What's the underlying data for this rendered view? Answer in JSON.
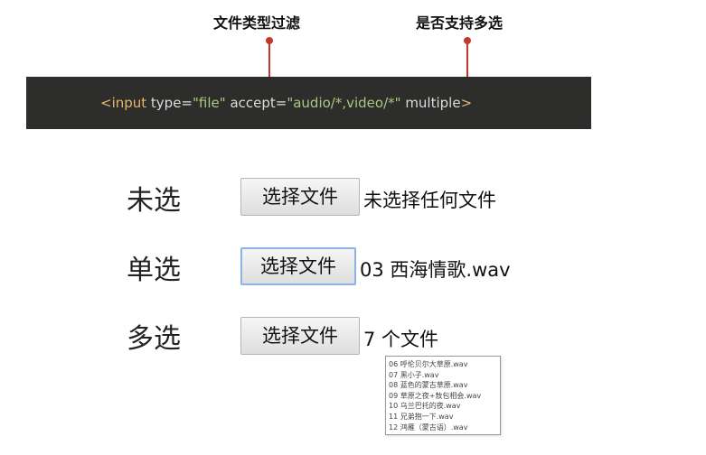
{
  "annotations": {
    "file_type_filter": "文件类型过滤",
    "multiple_select": "是否支持多选"
  },
  "colors": {
    "pointer": "#c0392b",
    "banner_bg": "#2d2d2b",
    "tag": "#e8b56a",
    "attr": "#dcdcdc",
    "value": "#a8c97f"
  },
  "code": {
    "open": "<input",
    "type_attr": " type=",
    "type_val": "\"file\"",
    "accept_attr": " accept=",
    "accept_val": "\"audio/*,video/*\"",
    "multiple_attr": " multiple",
    "close": ">"
  },
  "rows": {
    "none": {
      "label": "未选",
      "button": "选择文件",
      "status": "未选择任何文件"
    },
    "single": {
      "label": "单选",
      "button": "选择文件",
      "status": "03 西海情歌.wav"
    },
    "multi": {
      "label": "多选",
      "button": "选择文件",
      "status": "7 个文件"
    }
  },
  "tooltip": {
    "files": [
      "06 呼伦贝尔大草原.wav",
      "07 黑小子.wav",
      "08 蓝色的蒙古草原.wav",
      "09 草原之夜+敖包相会.wav",
      "10 乌兰巴托的夜.wav",
      "11 兄弟抱一下.wav",
      "12 鸿雁（蒙古语）.wav"
    ]
  }
}
